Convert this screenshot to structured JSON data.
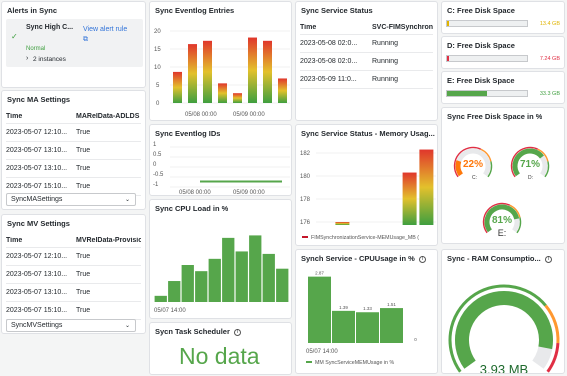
{
  "alerts": {
    "title": "Alerts in Sync",
    "alert_name": "Sync High C...",
    "state": "Normal",
    "instances": "2 instances",
    "link": "View alert rule",
    "icons": {
      "state": "check-icon",
      "expand": "chevron-right-icon",
      "link": "external-link-icon"
    }
  },
  "ma_settings": {
    "title": "Sync MA Settings",
    "columns": [
      "Time",
      "MARelData-ADLDS"
    ],
    "rows": [
      [
        "2023-05-07 12:10...",
        "True"
      ],
      [
        "2023-05-07 13:10...",
        "True"
      ],
      [
        "2023-05-07 13:10...",
        "True"
      ],
      [
        "2023-05-07 15:10...",
        "True"
      ]
    ],
    "select_value": "SyncMASettings"
  },
  "mv_settings": {
    "title": "Sync MV Settings",
    "columns": [
      "Time",
      "MVRelData-Provisio"
    ],
    "rows": [
      [
        "2023-05-07 12:10...",
        "True"
      ],
      [
        "2023-05-07 13:10...",
        "True"
      ],
      [
        "2023-05-07 13:10...",
        "True"
      ],
      [
        "2023-05-07 15:10...",
        "True"
      ]
    ],
    "select_value": "SyncMVSettings"
  },
  "eventlog_entries": {
    "title": "Sync Eventlog Entries",
    "y_ticks": [
      "20",
      "15",
      "10",
      "5",
      "0"
    ],
    "x_ticks": [
      "05/08 00:00",
      "05/09 00:00"
    ],
    "chart_data": {
      "type": "bar",
      "ylim": [
        0,
        22
      ],
      "categories": [
        "05/07 18:00",
        "05/08 00:00",
        "05/08 06:00",
        "05/08 12:00",
        "05/08 18:00",
        "05/09 00:00",
        "05/09 06:00",
        "05/09 12:00"
      ],
      "values": [
        9.5,
        18,
        19,
        6,
        3,
        20,
        19,
        7.5
      ],
      "color_scale": [
        "#3f9f3f",
        "#e3c12c",
        "#e0362c"
      ]
    }
  },
  "eventlog_ids": {
    "title": "Sync Eventlog IDs",
    "y_ticks": [
      "1",
      "0.5",
      "0",
      "-0.5",
      "-1"
    ],
    "x_ticks": [
      "05/08 00:00",
      "05/09 00:00"
    ],
    "chart_data": {
      "type": "bar",
      "ylim": [
        -1,
        1
      ],
      "series": [
        {
          "x_start": "05/08 06:00",
          "x_end": "05/09 18:00",
          "value": 0
        }
      ],
      "color": "#56a64b"
    }
  },
  "cpu_load": {
    "title": "Sync CPU Load in %",
    "x_ticks": [
      "05/07 14:00"
    ],
    "chart_data": {
      "type": "bar",
      "values": [
        5,
        17,
        30,
        25,
        35,
        52,
        41,
        54,
        39,
        27
      ],
      "ylim": [
        0,
        60
      ],
      "color": "#56a64b"
    }
  },
  "task_scheduler": {
    "title": "Sycn Task Scheduler",
    "message": "No data",
    "color": "#56a64b"
  },
  "service_status": {
    "title": "Sync Service Status",
    "columns": [
      "Time",
      "SVC-FIMSynchroniza"
    ],
    "rows": [
      [
        "2023-05-08 02:0...",
        "Running"
      ],
      [
        "2023-05-08 02:0...",
        "Running"
      ],
      [
        "2023-05-09 11:0...",
        "Running"
      ]
    ]
  },
  "memory_usage": {
    "title": "Sync Service Status - Memory Usag...",
    "y_ticks": [
      "182",
      "180",
      "178",
      "176"
    ],
    "legend": "FIMSynchronizationService-MEMUsage_MB (",
    "chart_data": {
      "type": "bar",
      "ylim": [
        175,
        183
      ],
      "values": [
        {
          "x": 0.22,
          "y": 176
        },
        {
          "x": 0.78,
          "y": 180.3
        },
        {
          "x": 0.92,
          "y": 182.3
        }
      ],
      "legend_color": "#c4162a"
    }
  },
  "cpu_usage": {
    "title": "Synch Service - CPUUsage in %",
    "x_tick": "05/07 14:00",
    "legend": "MM SyncServiceMEMUsage in %",
    "chart_data": {
      "type": "bar",
      "values": [
        2.87,
        1.39,
        1.33,
        1.51,
        0
      ],
      "labels": [
        "2.87",
        "1.39",
        "1.33",
        "1.51",
        "0"
      ],
      "ylim": [
        0,
        3.2
      ],
      "color": "#56a64b"
    }
  },
  "disk_c": {
    "title": "C: Free Disk Space",
    "value": "13.4 GB",
    "fraction": 0.02,
    "color": "#e0b400"
  },
  "disk_d": {
    "title": "D: Free Disk Space",
    "value": "7.24 GB",
    "fraction": 0.02,
    "color": "#e02f44"
  },
  "disk_e": {
    "title": "E: Free Disk Space",
    "value": "33.3 GB",
    "fraction": 0.5,
    "color": "#56a64b"
  },
  "disk_pct": {
    "title": "Sync Free Disk Space in %",
    "gauges": [
      {
        "label": "C:",
        "value": "22%",
        "fraction": 0.22,
        "color": "#ff780a"
      },
      {
        "label": "D:",
        "value": "71%",
        "fraction": 0.71,
        "color": "#56a64b"
      },
      {
        "label": "E:",
        "value": "81%",
        "fraction": 0.81,
        "color": "#56a64b"
      }
    ]
  },
  "ram": {
    "title": "Sync - RAM Consumptio...",
    "value": "3.93 MB",
    "fraction": 0.9,
    "color": "#56a64b"
  }
}
